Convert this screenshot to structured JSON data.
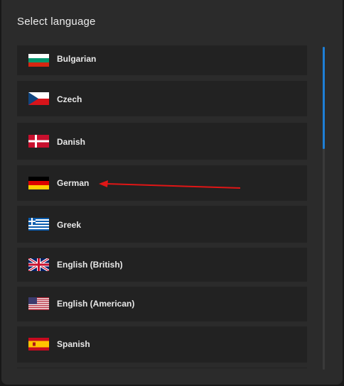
{
  "dialog": {
    "title": "Select language"
  },
  "languages": [
    {
      "label": "Bulgarian",
      "flag": "bulgaria-flag"
    },
    {
      "label": "Czech",
      "flag": "czech-flag"
    },
    {
      "label": "Danish",
      "flag": "denmark-flag"
    },
    {
      "label": "German",
      "flag": "germany-flag"
    },
    {
      "label": "Greek",
      "flag": "greece-flag"
    },
    {
      "label": "English (British)",
      "flag": "uk-flag"
    },
    {
      "label": "English (American)",
      "flag": "us-flag"
    },
    {
      "label": "Spanish",
      "flag": "spain-flag"
    }
  ],
  "scrollbar": {
    "thumb_color": "#1e7fd6"
  },
  "annotation": {
    "arrow_color": "#e01616",
    "points_to": "German"
  }
}
